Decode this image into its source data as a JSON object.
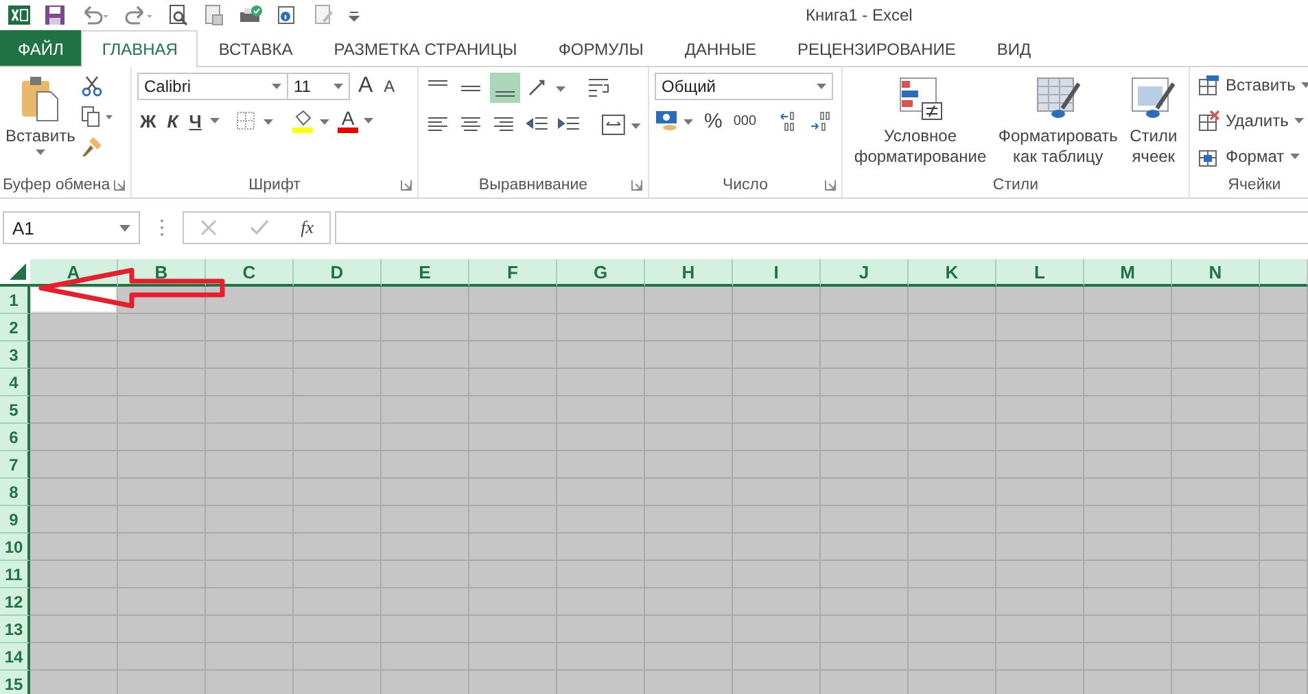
{
  "window": {
    "title": "Книга1 - Excel"
  },
  "tabs": [
    {
      "label": "ФАЙЛ",
      "kind": "file",
      "selected": false
    },
    {
      "label": "ГЛАВНАЯ",
      "kind": "tab",
      "selected": true
    },
    {
      "label": "ВСТАВКА",
      "kind": "tab",
      "selected": false
    },
    {
      "label": "РАЗМЕТКА СТРАНИЦЫ",
      "kind": "tab",
      "selected": false
    },
    {
      "label": "ФОРМУЛЫ",
      "kind": "tab",
      "selected": false
    },
    {
      "label": "ДАННЫЕ",
      "kind": "tab",
      "selected": false
    },
    {
      "label": "РЕЦЕНЗИРОВАНИЕ",
      "kind": "tab",
      "selected": false
    },
    {
      "label": "ВИД",
      "kind": "tab",
      "selected": false
    }
  ],
  "ribbon": {
    "clipboard": {
      "label": "Буфер обмена",
      "paste": "Вставить"
    },
    "font": {
      "label": "Шрифт",
      "font_name": "Calibri",
      "font_size": "11",
      "grow": "A",
      "shrink": "A",
      "bold": "Ж",
      "italic": "К",
      "underline": "Ч",
      "font_color": "A"
    },
    "alignment": {
      "label": "Выравнивание"
    },
    "number": {
      "label": "Число",
      "format": "Общий",
      "percent": "%",
      "thousands": "000"
    },
    "styles": {
      "label": "Стили",
      "buttons": [
        "Условное\nформатирование",
        "Форматировать\nкак таблицу",
        "Стили\nячеек"
      ]
    },
    "cells": {
      "label": "Ячейки",
      "buttons": [
        "Вставить",
        "Удалить",
        "Формат"
      ]
    }
  },
  "formula_bar": {
    "name_box": "A1",
    "function_label": "fx"
  },
  "sheet": {
    "columns": [
      {
        "label": "A",
        "selected": true,
        "active": true
      },
      {
        "label": "B",
        "selected": true,
        "active": false
      },
      {
        "label": "C",
        "selected": true,
        "active": false
      },
      {
        "label": "D",
        "selected": true,
        "active": false
      },
      {
        "label": "E",
        "selected": true,
        "active": false
      },
      {
        "label": "F",
        "selected": true,
        "active": false
      },
      {
        "label": "G",
        "selected": true,
        "active": false
      },
      {
        "label": "H",
        "selected": true,
        "active": false
      },
      {
        "label": "I",
        "selected": true,
        "active": false
      },
      {
        "label": "J",
        "selected": true,
        "active": false
      },
      {
        "label": "K",
        "selected": true,
        "active": false
      },
      {
        "label": "L",
        "selected": true,
        "active": false
      },
      {
        "label": "M",
        "selected": true,
        "active": false
      },
      {
        "label": "N",
        "selected": true,
        "active": false
      }
    ],
    "rows": [
      {
        "label": "1",
        "selected": true,
        "active": true
      },
      {
        "label": "2",
        "selected": true,
        "active": false
      },
      {
        "label": "3",
        "selected": true,
        "active": false
      },
      {
        "label": "4",
        "selected": true,
        "active": false
      },
      {
        "label": "5",
        "selected": true,
        "active": false
      },
      {
        "label": "6",
        "selected": true,
        "active": false
      },
      {
        "label": "7",
        "selected": true,
        "active": false
      },
      {
        "label": "8",
        "selected": true,
        "active": false
      },
      {
        "label": "9",
        "selected": true,
        "active": false
      },
      {
        "label": "10",
        "selected": true,
        "active": false
      },
      {
        "label": "11",
        "selected": true,
        "active": false
      },
      {
        "label": "12",
        "selected": true,
        "active": false
      },
      {
        "label": "13",
        "selected": true,
        "active": false
      },
      {
        "label": "14",
        "selected": true,
        "active": false
      },
      {
        "label": "15",
        "selected": true,
        "active": false
      }
    ]
  },
  "annotation": {
    "kind": "arrow"
  }
}
